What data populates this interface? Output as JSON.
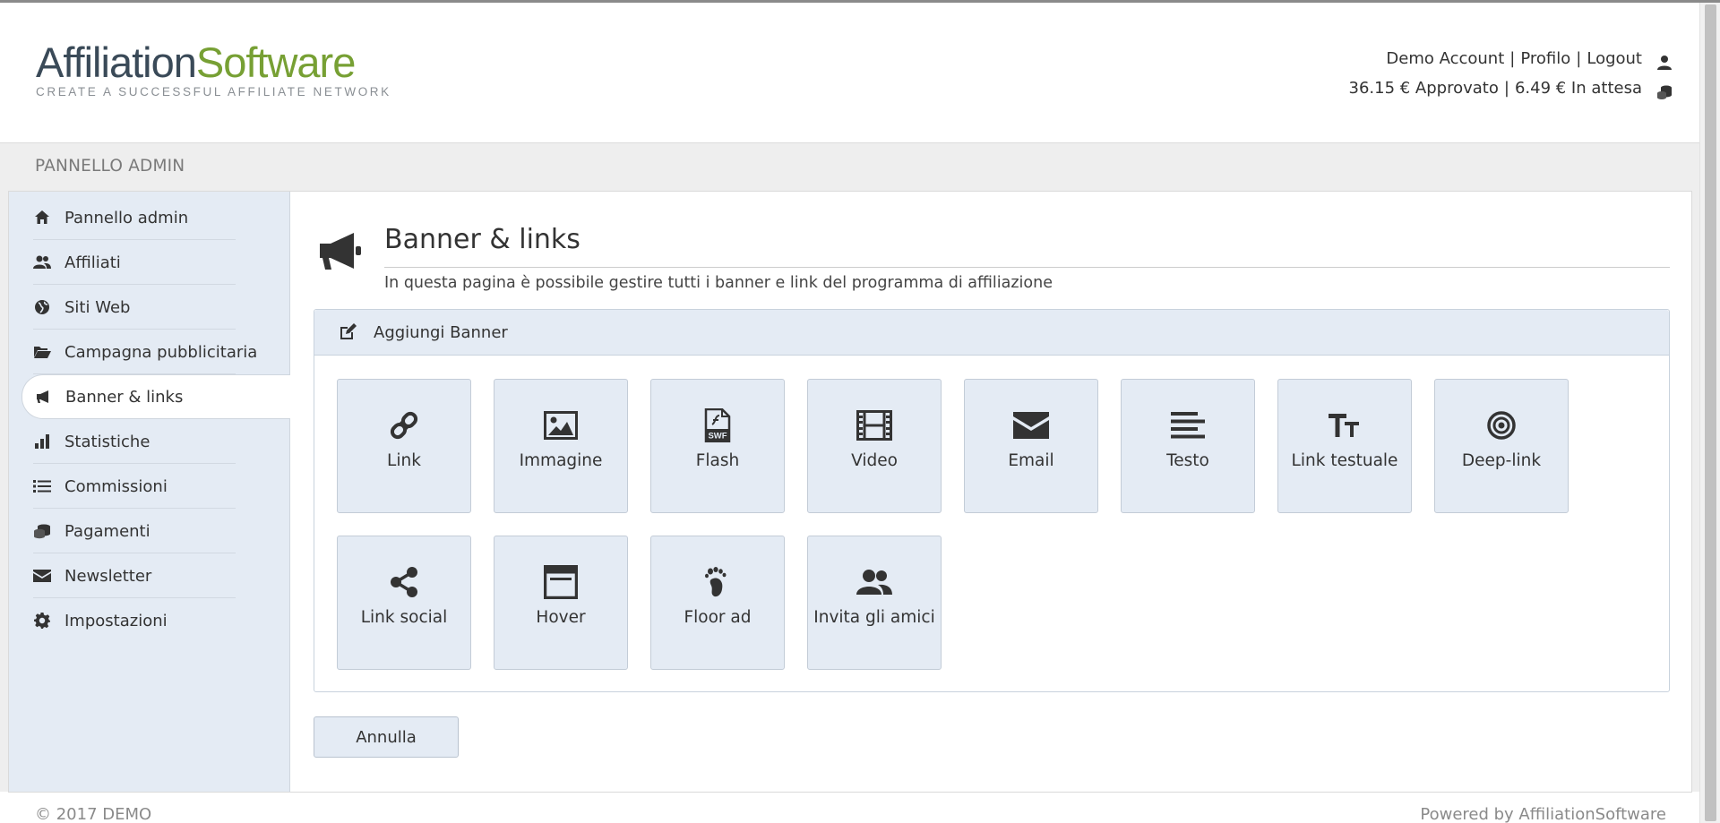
{
  "brand": {
    "logo_part1": "Affiliation",
    "logo_part2": "Software",
    "tagline": "CREATE A SUCCESSFUL AFFILIATE NETWORK",
    "color_dark": "#3a4a58",
    "color_green": "#77a034"
  },
  "account": {
    "name": "Demo Account",
    "profile": "Profilo",
    "logout": "Logout",
    "approved": "36.15 € Approvato",
    "pending": "6.49 € In attesa",
    "separator": "|"
  },
  "panel": {
    "title": "PANNELLO ADMIN"
  },
  "sidebar": {
    "items": [
      {
        "label": "Pannello admin",
        "icon": "home-icon"
      },
      {
        "label": "Affiliati",
        "icon": "users-icon"
      },
      {
        "label": "Siti Web",
        "icon": "globe-icon"
      },
      {
        "label": "Campagna pubblicitaria",
        "icon": "folder-open-icon"
      },
      {
        "label": "Banner & links",
        "icon": "megaphone-icon",
        "active": true
      },
      {
        "label": "Statistiche",
        "icon": "bar-chart-icon"
      },
      {
        "label": "Commissioni",
        "icon": "list-icon"
      },
      {
        "label": "Pagamenti",
        "icon": "coins-icon"
      },
      {
        "label": "Newsletter",
        "icon": "envelope-icon"
      },
      {
        "label": "Impostazioni",
        "icon": "gear-icon"
      }
    ]
  },
  "page": {
    "title": "Banner & links",
    "subtitle": "In questa pagina è possibile gestire tutti i banner e link del programma di affiliazione"
  },
  "add_banner": {
    "header": "Aggiungi Banner",
    "tiles": [
      {
        "label": "Link",
        "icon": "link-icon"
      },
      {
        "label": "Immagine",
        "icon": "image-icon"
      },
      {
        "label": "Flash",
        "icon": "flash-swf-icon"
      },
      {
        "label": "Video",
        "icon": "film-icon"
      },
      {
        "label": "Email",
        "icon": "envelope-icon"
      },
      {
        "label": "Testo",
        "icon": "text-lines-icon"
      },
      {
        "label": "Link testuale",
        "icon": "text-size-icon"
      },
      {
        "label": "Deep-link",
        "icon": "target-icon"
      },
      {
        "label": "Link social",
        "icon": "share-icon"
      },
      {
        "label": "Hover",
        "icon": "window-icon"
      },
      {
        "label": "Floor ad",
        "icon": "footprint-icon"
      },
      {
        "label": "Invita gli amici",
        "icon": "users-icon"
      }
    ]
  },
  "buttons": {
    "cancel": "Annulla"
  },
  "footer": {
    "copyright": "© 2017 DEMO",
    "powered": "Powered by AffiliationSoftware"
  },
  "colors": {
    "panel_blue": "#e4ebf4",
    "border_blue": "#c3ccd7"
  }
}
